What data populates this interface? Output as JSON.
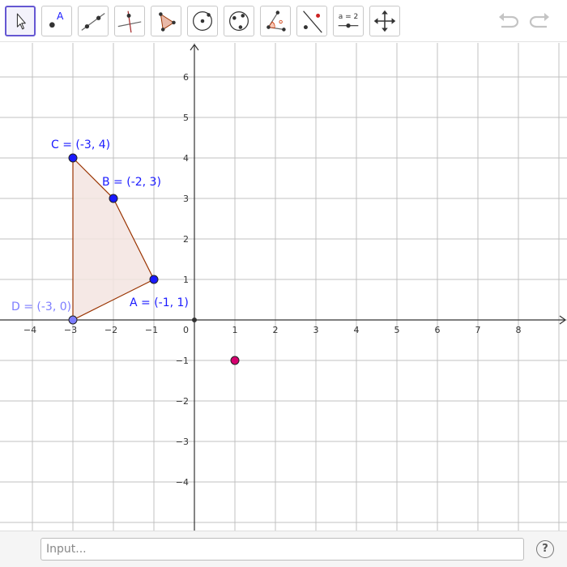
{
  "toolbar": {
    "tools": [
      {
        "name": "move",
        "icon": "arrow-cursor-icon",
        "selected": true
      },
      {
        "name": "point",
        "icon": "point-icon",
        "label": "A"
      },
      {
        "name": "line",
        "icon": "line-through-two-points-icon"
      },
      {
        "name": "perpendicular-line",
        "icon": "perpendicular-line-icon"
      },
      {
        "name": "polygon",
        "icon": "polygon-icon"
      },
      {
        "name": "circle-center-point",
        "icon": "circle-center-icon"
      },
      {
        "name": "circle-three-points",
        "icon": "circle-three-points-icon"
      },
      {
        "name": "angle",
        "icon": "angle-icon"
      },
      {
        "name": "reflect",
        "icon": "reflect-about-line-icon"
      },
      {
        "name": "slider",
        "icon": "slider-icon",
        "label": "a = 2"
      },
      {
        "name": "move-graphics-view",
        "icon": "move-graphics-view-icon"
      }
    ],
    "undo_icon": "undo-icon",
    "redo_icon": "redo-icon"
  },
  "graphics": {
    "x_ticks": [
      "−4",
      "−3",
      "−2",
      "−1",
      "1",
      "2",
      "3",
      "4",
      "5",
      "6",
      "7",
      "8"
    ],
    "y_ticks": [
      "6",
      "5",
      "4",
      "3",
      "2",
      "1",
      "−1",
      "−2",
      "−3",
      "−4"
    ],
    "origin_label": "0",
    "points": [
      {
        "name": "A",
        "x": -1,
        "y": 1,
        "label": "A = (-1, 1)",
        "color": "#1a1aff"
      },
      {
        "name": "B",
        "x": -2,
        "y": 3,
        "label": "B = (-2, 3)",
        "color": "#1a1aff"
      },
      {
        "name": "C",
        "x": -3,
        "y": 4,
        "label": "C = (-3, 4)",
        "color": "#1a1aff"
      },
      {
        "name": "D",
        "x": -3,
        "y": 0,
        "label": "D = (-3, 0)",
        "color": "#7d7dff"
      },
      {
        "name": "E",
        "x": 1,
        "y": -1,
        "label": "",
        "color": "#d6006f"
      }
    ],
    "polygon": {
      "vertices": [
        "C",
        "B",
        "A",
        "D"
      ],
      "fill": "#f3e4e1",
      "stroke": "#993300"
    },
    "axis_color": "#333333",
    "grid_color": "#c0c0c0"
  },
  "input_bar": {
    "placeholder": "Input...",
    "value": "",
    "help_icon": "help-icon",
    "help_label": "?"
  }
}
